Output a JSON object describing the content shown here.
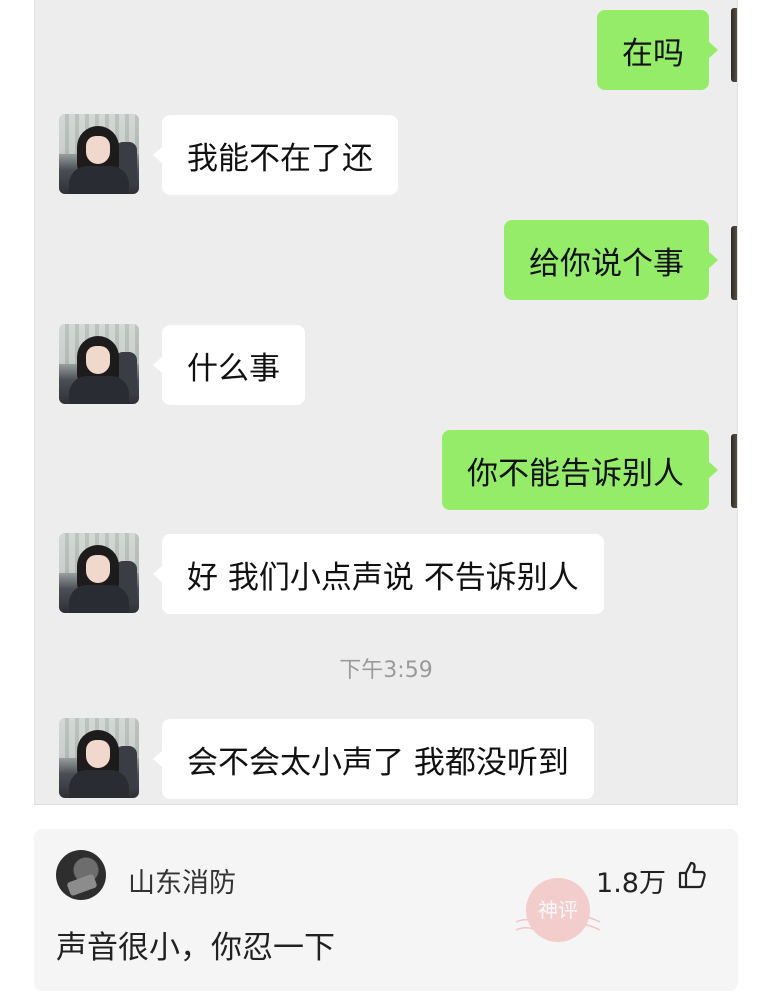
{
  "chat": {
    "messages": [
      {
        "side": "out",
        "text": "在吗"
      },
      {
        "side": "in",
        "text": "我能不在了还"
      },
      {
        "side": "out",
        "text": "给你说个事"
      },
      {
        "side": "in",
        "text": "什么事"
      },
      {
        "side": "out",
        "text": "你不能告诉别人"
      },
      {
        "side": "in",
        "text": "好 我们小点声说 不告诉别人"
      },
      {
        "side": "in",
        "text": "会不会太小声了 我都没听到"
      }
    ],
    "timestamp": "下午3:59"
  },
  "comment": {
    "user_name": "山东消防",
    "likes": "1.8万",
    "text": "声音很小，你忍一下",
    "badge_text": "神评",
    "thumb_icon": "thumbs-up-icon",
    "bubble_color_out": "#95ec69",
    "bubble_color_in": "#ffffff"
  }
}
